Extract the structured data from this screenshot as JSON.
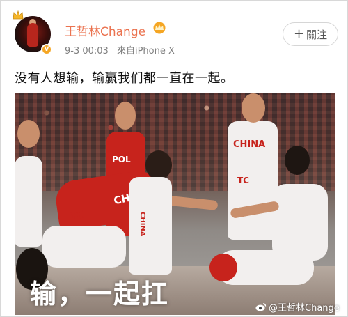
{
  "post": {
    "username": "王哲林Change",
    "date": "9-3 00:03",
    "source": "來自iPhone X",
    "follow_label": "關注",
    "text": "没有人想输，输赢我们都一直在一起。"
  },
  "image": {
    "overlay_caption": "输，一起扛",
    "watermark": "@王哲林Change",
    "jersey_texts": [
      "CHINA",
      "POL",
      "CHINA",
      "CHINA",
      "TC",
      "TC"
    ]
  },
  "colors": {
    "username": "#eb7350",
    "meta": "#808080",
    "vip_badge": "#f5a623",
    "jersey_red": "#c7231c"
  },
  "icons": {
    "vip": "crown-vip-icon",
    "verified": "verified-v-icon",
    "follow": "plus-icon",
    "weibo": "weibo-logo-icon"
  }
}
